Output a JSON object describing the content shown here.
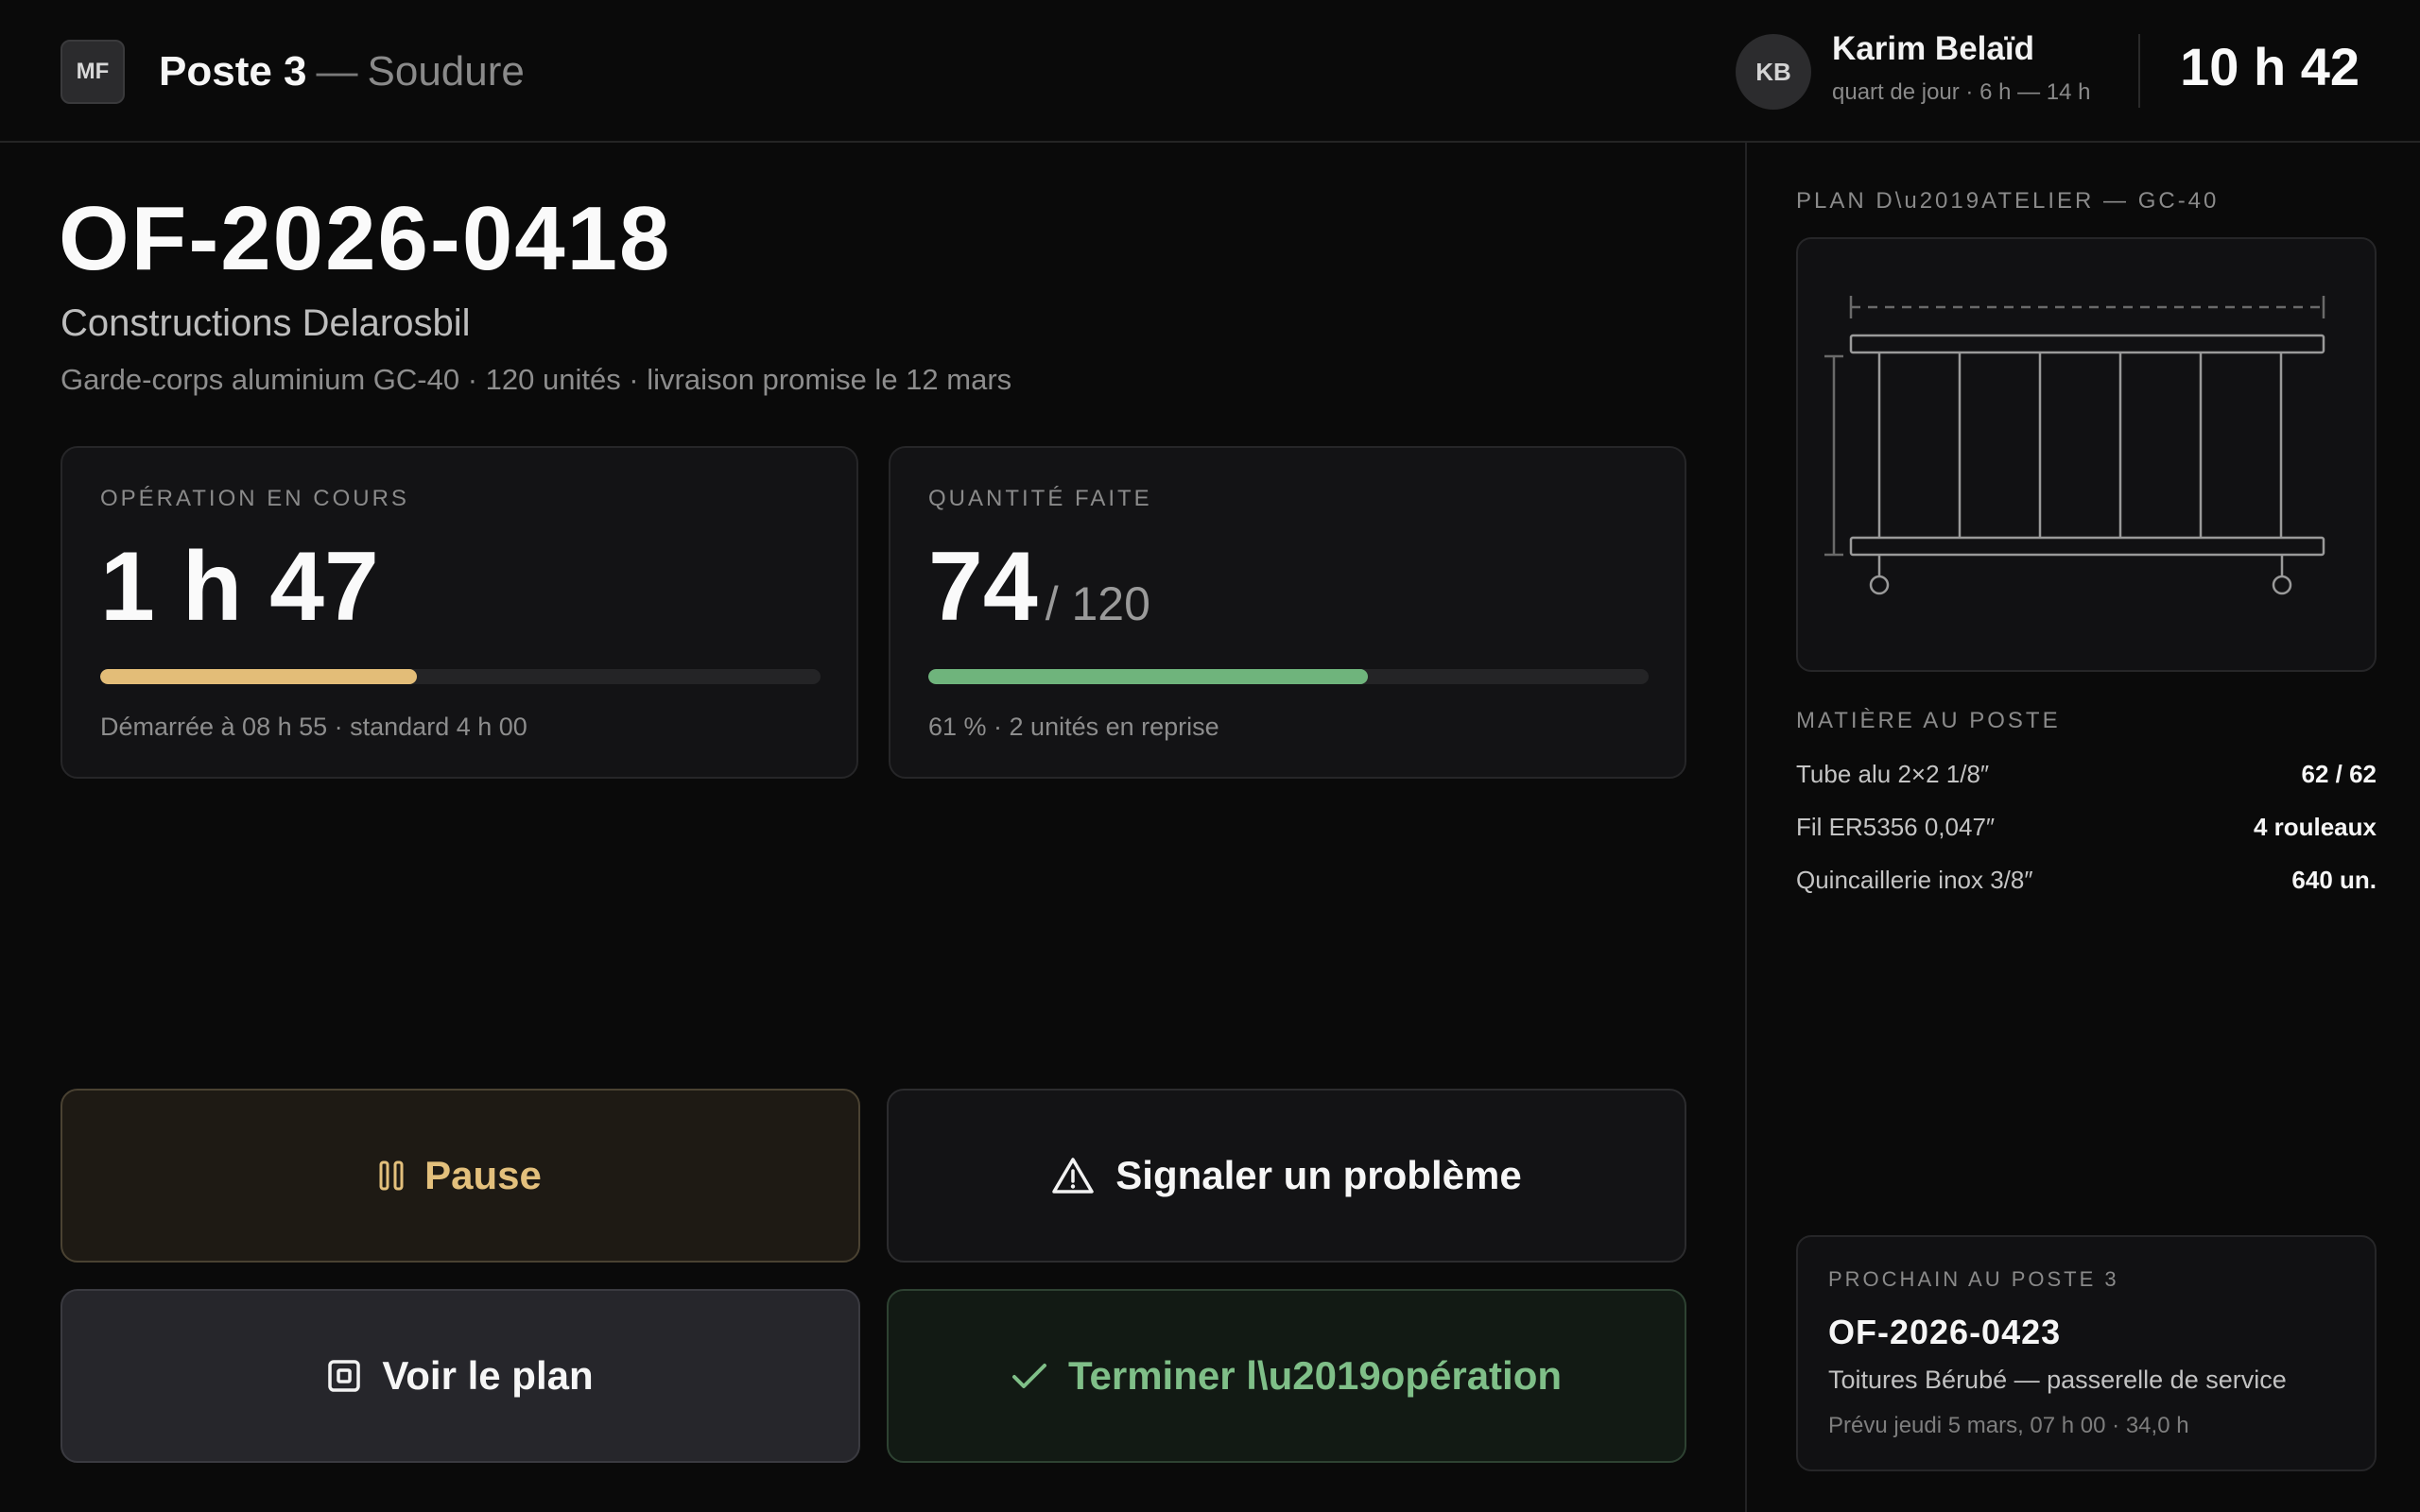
{
  "header": {
    "logo": "MF",
    "station_number": "Poste 3",
    "station_separator": "—",
    "station_name": "Soudure",
    "user_initials": "KB",
    "user_name": "Karim Belaïd",
    "user_shift": "quart de jour · 6 h — 14 h",
    "clock": "10 h 42"
  },
  "order": {
    "id": "OF-2026-0418",
    "client": "Constructions Delarosbil",
    "description": "Garde-corps aluminium GC-40 · 120 unités · livraison promise le 12 mars"
  },
  "operation_card": {
    "label": "OPÉRATION EN COURS",
    "value": "1 h 47",
    "progress": 0.44,
    "bar_color": "#e3bd78",
    "note": "Démarrée à 08 h 55 · standard 4 h 00"
  },
  "quantity_card": {
    "label": "QUANTITÉ FAITE",
    "done": "74",
    "total": "/ 120",
    "progress": 0.61,
    "bar_color": "#6fb47c",
    "note": "61 % · 2 unités en reprise"
  },
  "actions": {
    "pause_label": "Pause",
    "issue_label": "Signaler un problème",
    "plan_label": "Voir le plan",
    "finish_label": "Terminer l\\u2019opération"
  },
  "side": {
    "plan_title": "PLAN D\\u2019ATELIER — GC-40",
    "materials_title": "MATIÈRE AU POSTE",
    "materials": [
      {
        "name": "Tube alu 2×2 1/8″",
        "qty": "62 / 62"
      },
      {
        "name": "Fil ER5356 0,047″",
        "qty": "4 rouleaux"
      },
      {
        "name": "Quincaillerie inox 3/8″",
        "qty": "640 un."
      }
    ],
    "next": {
      "label": "PROCHAIN AU POSTE 3",
      "id": "OF-2026-0423",
      "description": "Toitures Bérubé — passerelle de service",
      "schedule": "Prévu jeudi 5 mars, 07 h 00 · 34,0 h"
    }
  },
  "icons": {
    "pause": "pause-icon",
    "issue": "warning-triangle-icon",
    "plan": "plan-frame-icon",
    "finish": "check-icon"
  },
  "colors": {
    "background": "#0a0a0a",
    "pause_accent": "#e3c07c",
    "finish_accent": "#7fbf88"
  }
}
